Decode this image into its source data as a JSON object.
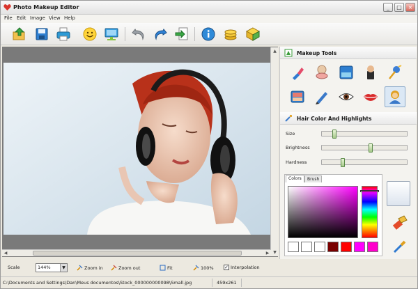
{
  "window": {
    "title": "Photo Makeup Editor",
    "buttons": {
      "minimize": "_",
      "maximize": "□",
      "close": "×"
    }
  },
  "menu": [
    "File",
    "Edit",
    "Image",
    "View",
    "Help"
  ],
  "toolbar": {
    "icons": [
      "open-icon",
      "save-icon",
      "print-icon",
      "smiley-icon",
      "monitor-icon",
      "undo-icon",
      "redo-icon",
      "export-icon",
      "info-icon",
      "coins-icon",
      "box-icon"
    ]
  },
  "canvas": {
    "photo_description_icon": "portrait-photo"
  },
  "bottom": {
    "scale_label": "Scale",
    "scale_value": "144%",
    "zoom_in": "Zoom in",
    "zoom_out": "Zoom out",
    "fit": "Fit",
    "hundred": "100%",
    "interpolation": "Interpolation",
    "interpolation_checked": true
  },
  "status": {
    "path": "C:\\Documents and Settings\\Dan\\Meus documentos\\Stock_000000000098\\Small.jpg",
    "dimensions": "459x261"
  },
  "makeup_tools": {
    "header": "Makeup Tools",
    "tools": [
      "lipstick-icon",
      "compact-powder-icon",
      "eyeshadow-palette-icon",
      "foundation-icon",
      "pin-icon",
      "blush-palette-icon",
      "eyeliner-pencil-icon",
      "eye-icon",
      "lips-icon",
      "hair-user-icon"
    ],
    "active_index": 9
  },
  "hair": {
    "header": "Hair Color And Highlights",
    "sliders": [
      {
        "label": "Size",
        "value": 0.12
      },
      {
        "label": "Brightness",
        "value": 0.55
      },
      {
        "label": "Hardness",
        "value": 0.22
      }
    ]
  },
  "colors": {
    "tabs": [
      "Colors",
      "Brush"
    ],
    "active_tab": "Colors",
    "swatches": [
      "#ffffff",
      "#ffffff",
      "#ffffff",
      "#7a0000",
      "#ff0000",
      "#ff00ff",
      "#ff00cc"
    ]
  }
}
